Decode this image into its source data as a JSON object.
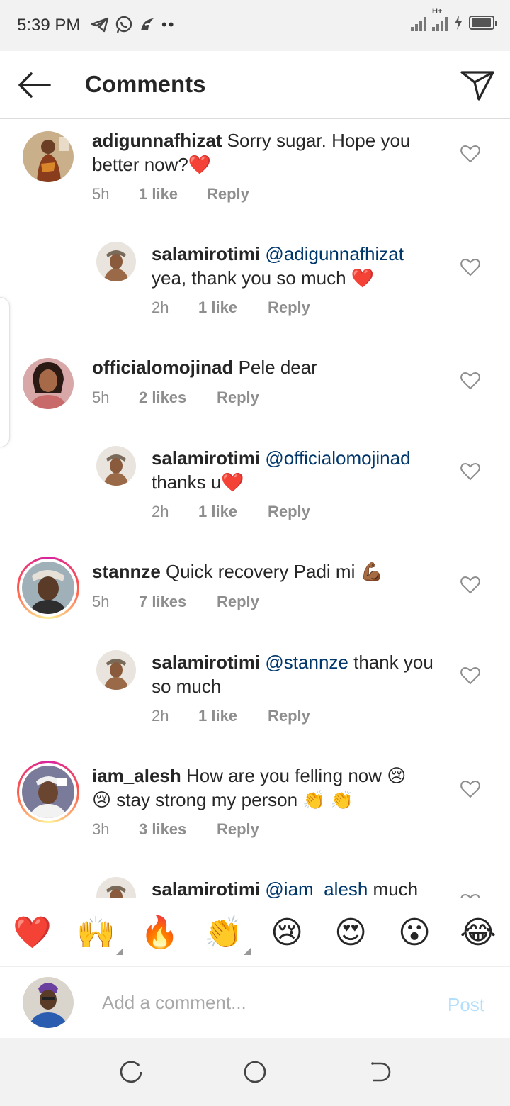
{
  "status_bar": {
    "time": "5:39 PM",
    "app_icons": [
      "telegram-icon",
      "whatsapp-icon",
      "app-icon"
    ],
    "dots": "••",
    "network": "H+",
    "battery_level": 0.95
  },
  "header": {
    "title": "Comments",
    "back_icon": "back-arrow-icon",
    "send_icon": "direct-send-icon"
  },
  "comments": [
    {
      "username": "adigunnafhizat",
      "text": "Sorry sugar. Hope you better now?❤️",
      "mention": "",
      "time": "5h",
      "likes": "1 like",
      "reply_label": "Reply",
      "story_ring": false
    },
    {
      "username": "salamirotimi",
      "mention": "@adigunnafhizat",
      "text": "yea, thank you so much ❤️",
      "time": "2h",
      "likes": "1 like",
      "reply_label": "Reply",
      "is_reply": true
    },
    {
      "username": "officialomojinad",
      "text": "Pele dear",
      "mention": "",
      "time": "5h",
      "likes": "2 likes",
      "reply_label": "Reply",
      "story_ring": false
    },
    {
      "username": "salamirotimi",
      "mention": "@officialomojinad",
      "text": "thanks u❤️",
      "time": "2h",
      "likes": "1 like",
      "reply_label": "Reply",
      "is_reply": true
    },
    {
      "username": "stannze",
      "text": "Quick recovery Padi mi 💪🏾",
      "mention": "",
      "time": "5h",
      "likes": "7 likes",
      "reply_label": "Reply",
      "story_ring": true
    },
    {
      "username": "salamirotimi",
      "mention": "@stannze",
      "text": "thank you so much",
      "time": "2h",
      "likes": "1 like",
      "reply_label": "Reply",
      "is_reply": true
    },
    {
      "username": "iam_alesh",
      "text": "How are you felling now 😢 😢 stay strong my person 👏 👏",
      "mention": "",
      "time": "3h",
      "likes": "3 likes",
      "reply_label": "Reply",
      "story_ring": true
    },
    {
      "username": "salamirotimi",
      "mention": "@iam_alesh",
      "text": "much",
      "time": "",
      "likes": "",
      "reply_label": "",
      "is_reply": true
    }
  ],
  "emoji_bar": [
    "❤️",
    "🙌",
    "🔥",
    "👏",
    "😢",
    "😍",
    "😮",
    "😂"
  ],
  "input": {
    "placeholder": "Add a comment...",
    "post_label": "Post"
  },
  "nav_bar": {
    "buttons": [
      "recents-icon",
      "home-circle-icon",
      "back-nav-icon"
    ]
  }
}
